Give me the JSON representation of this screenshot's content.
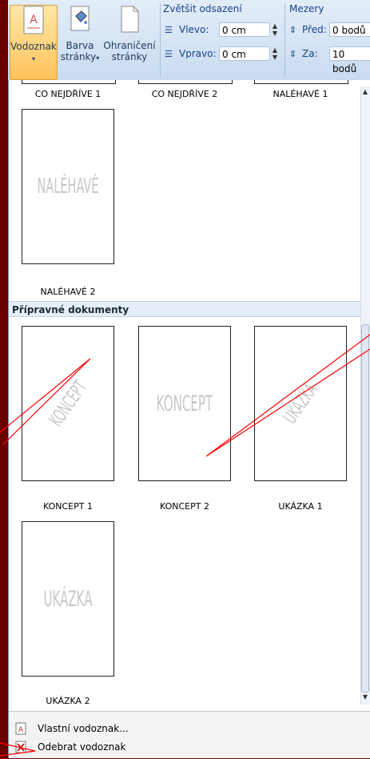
{
  "ribbon": {
    "watermark_button": "Vodoznak",
    "page_color_button": {
      "line1": "Barva",
      "line2": "stránky"
    },
    "page_border_button": {
      "line1": "Ohraničení",
      "line2": "stránky"
    },
    "indent_group": {
      "title": "Zvětšit odsazení",
      "left_label": "Vlevo:",
      "left_value": "0 cm",
      "right_label": "Vpravo:",
      "right_value": "0 cm"
    },
    "spacing_group": {
      "title": "Mezery",
      "before_label": "Před:",
      "before_value": "0 bodů",
      "after_label": "Za:",
      "after_value": "10 bodů"
    }
  },
  "gallery": {
    "top_labels": [
      "CO NEJDŘÍVE 1",
      "CO NEJDŘÍVE 2",
      "NALÉHAVÉ 1"
    ],
    "urgent2": {
      "caption": "NALÉHAVÉ 2",
      "watermark": "NALÉHAVÉ"
    },
    "section_title": "Přípravné dokumenty",
    "items": [
      {
        "caption": "KONCEPT 1",
        "watermark": "KONCEPT"
      },
      {
        "caption": "KONCEPT 2",
        "watermark": "KONCEPT"
      },
      {
        "caption": "UKÁZKA 1",
        "watermark": "UKÁZKA"
      },
      {
        "caption": "UKÁZKA 2",
        "watermark": "UKÁZKA"
      }
    ]
  },
  "menu": {
    "custom_watermark": "Vlastní vodoznak...",
    "remove_watermark": "Odebrat vodoznak"
  },
  "colors": {
    "background": "#7a0a0a",
    "ribbon": "#dbe6f4",
    "active_button": "#ffc35a",
    "arrow": "#ff0000"
  }
}
